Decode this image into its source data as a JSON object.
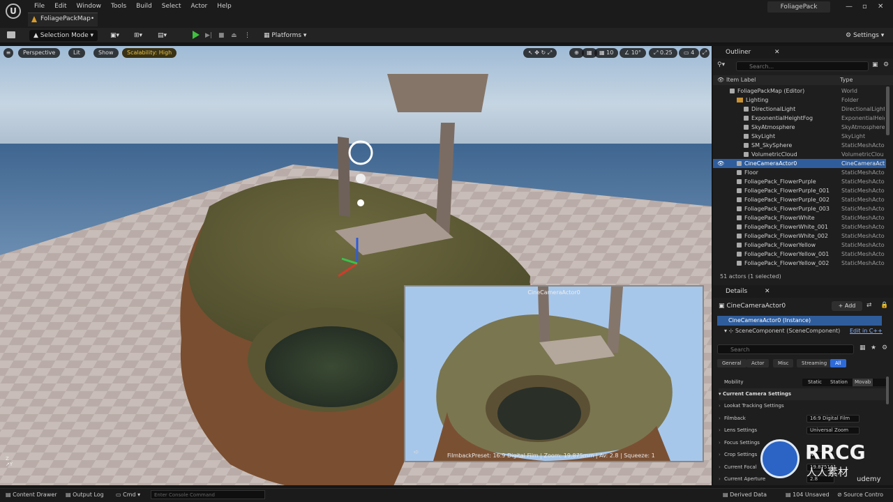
{
  "menu": [
    "File",
    "Edit",
    "Window",
    "Tools",
    "Build",
    "Select",
    "Actor",
    "Help"
  ],
  "doc_tab": "FoliagePackMap•",
  "project": "FoliagePack",
  "toolbar": {
    "mode": "Selection Mode",
    "platforms": "Platforms",
    "settings": "Settings"
  },
  "viewport": {
    "perspective": "Perspective",
    "lit": "Lit",
    "show": "Show",
    "scalability": "Scalability: High",
    "grid_snap": "10",
    "rot_snap": "10°",
    "scale_snap": "0.25",
    "cam_speed": "4",
    "pip_title": "CineCameraActor0",
    "pip_info": "FilmbackPreset: 16:9 Digital Film | Zoom: 19.875mm | Av: 2.8 | Squeeze: 1"
  },
  "outliner": {
    "title": "Outliner",
    "search": "Search...",
    "col_label": "Item Label",
    "col_type": "Type",
    "rows": [
      {
        "label": "FoliagePackMap (Editor)",
        "type": "World",
        "indent": 1,
        "kind": "world"
      },
      {
        "label": "Lighting",
        "type": "Folder",
        "indent": 2,
        "kind": "folder"
      },
      {
        "label": "DirectionalLight",
        "type": "DirectionalLight",
        "indent": 3,
        "kind": "actor"
      },
      {
        "label": "ExponentialHeightFog",
        "type": "ExponentialHeig",
        "indent": 3,
        "kind": "actor"
      },
      {
        "label": "SkyAtmosphere",
        "type": "SkyAtmosphere",
        "indent": 3,
        "kind": "actor"
      },
      {
        "label": "SkyLight",
        "type": "SkyLight",
        "indent": 3,
        "kind": "actor"
      },
      {
        "label": "SM_SkySphere",
        "type": "StaticMeshActo",
        "indent": 3,
        "kind": "actor"
      },
      {
        "label": "VolumetricCloud",
        "type": "VolumetricClou",
        "indent": 3,
        "kind": "actor"
      },
      {
        "label": "CineCameraActor0",
        "type": "CineCameraActo",
        "indent": 2,
        "kind": "actor",
        "selected": true
      },
      {
        "label": "Floor",
        "type": "StaticMeshActo",
        "indent": 2,
        "kind": "actor"
      },
      {
        "label": "FoliagePack_FlowerPurple",
        "type": "StaticMeshActo",
        "indent": 2,
        "kind": "actor"
      },
      {
        "label": "FoliagePack_FlowerPurple_001",
        "type": "StaticMeshActo",
        "indent": 2,
        "kind": "actor"
      },
      {
        "label": "FoliagePack_FlowerPurple_002",
        "type": "StaticMeshActo",
        "indent": 2,
        "kind": "actor"
      },
      {
        "label": "FoliagePack_FlowerPurple_003",
        "type": "StaticMeshActo",
        "indent": 2,
        "kind": "actor"
      },
      {
        "label": "FoliagePack_FlowerWhite",
        "type": "StaticMeshActo",
        "indent": 2,
        "kind": "actor"
      },
      {
        "label": "FoliagePack_FlowerWhite_001",
        "type": "StaticMeshActo",
        "indent": 2,
        "kind": "actor"
      },
      {
        "label": "FoliagePack_FlowerWhite_002",
        "type": "StaticMeshActo",
        "indent": 2,
        "kind": "actor"
      },
      {
        "label": "FoliagePack_FlowerYellow",
        "type": "StaticMeshActo",
        "indent": 2,
        "kind": "actor"
      },
      {
        "label": "FoliagePack_FlowerYellow_001",
        "type": "StaticMeshActo",
        "indent": 2,
        "kind": "actor"
      },
      {
        "label": "FoliagePack_FlowerYellow_002",
        "type": "StaticMeshActo",
        "indent": 2,
        "kind": "actor"
      }
    ],
    "status": "51 actors (1 selected)"
  },
  "details": {
    "title": "Details",
    "actor": "CineCameraActor0",
    "add": "+ Add",
    "instance": "CineCameraActor0 (Instance)",
    "component": "SceneComponent (SceneComponent)",
    "edit_cpp": "Edit in C++",
    "search": "Search",
    "filters": [
      "General",
      "Actor",
      "Misc",
      "Streaming",
      "All"
    ],
    "mobility_label": "Mobility",
    "mobility": [
      "Static",
      "Station",
      "Movab"
    ],
    "section": "Current Camera Settings",
    "rows": [
      {
        "label": "Lookat Tracking Settings",
        "value": ""
      },
      {
        "label": "Filmback",
        "value": "16:9 Digital Film"
      },
      {
        "label": "Lens Settings",
        "value": "Universal Zoom"
      },
      {
        "label": "Focus Settings",
        "value": ""
      },
      {
        "label": "Crop Settings",
        "value": "No"
      },
      {
        "label": "Current Focal",
        "value": "19.875161"
      },
      {
        "label": "Current Aperture",
        "value": "2.8"
      }
    ]
  },
  "bottom": {
    "content_drawer": "Content Drawer",
    "output_log": "Output Log",
    "cmd": "Cmd",
    "console_placeholder": "Enter Console Command",
    "derived_data": "Derived Data",
    "unsaved": "104 Unsaved",
    "source_control": "Source Contro"
  },
  "watermark": {
    "brand": "RRCG",
    "sub": "人人素材",
    "udemy": "udemy"
  }
}
